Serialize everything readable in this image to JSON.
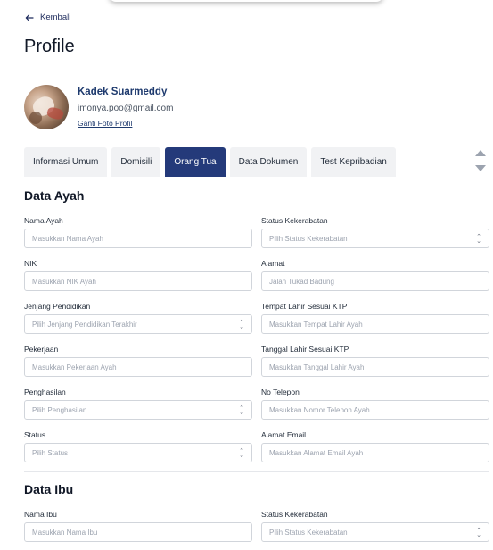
{
  "nav": {
    "back_label": "Kembali"
  },
  "page": {
    "title": "Profile"
  },
  "user": {
    "name": "Kadek Suarmeddy",
    "email": "imonya.poo@gmail.com",
    "change_photo_label": "Ganti Foto Profil"
  },
  "tabs": [
    {
      "label": "Informasi Umum",
      "active": false
    },
    {
      "label": "Domisili",
      "active": false
    },
    {
      "label": "Orang Tua",
      "active": true
    },
    {
      "label": "Data Dokumen",
      "active": false
    },
    {
      "label": "Test Kepribadian",
      "active": false
    }
  ],
  "ayah": {
    "title": "Data Ayah",
    "fields": {
      "nama": {
        "label": "Nama Ayah",
        "placeholder": "Masukkan Nama Ayah"
      },
      "status": {
        "label": "Status Kekerabatan",
        "placeholder": "Pilih Status Kekerabatan"
      },
      "nik": {
        "label": "NIK",
        "placeholder": "Masukkan NIK Ayah"
      },
      "alamat": {
        "label": "Alamat",
        "placeholder": "Jalan Tukad Badung"
      },
      "jenjang": {
        "label": "Jenjang Pendidikan",
        "placeholder": "Pilih Jenjang Pendidikan Terakhir"
      },
      "tempat_lahir": {
        "label": "Tempat Lahir Sesuai KTP",
        "placeholder": "Masukkan Tempat Lahir Ayah"
      },
      "pekerjaan": {
        "label": "Pekerjaan",
        "placeholder": "Masukkan Pekerjaan Ayah"
      },
      "tanggal_lahir": {
        "label": "Tanggal Lahir Sesuai KTP",
        "placeholder": "Masukkan Tanggal Lahir Ayah"
      },
      "penghasilan": {
        "label": "Penghasilan",
        "placeholder": "Pilih Penghasilan"
      },
      "telepon": {
        "label": "No Telepon",
        "placeholder": "Masukkan Nomor Telepon Ayah"
      },
      "status_hidup": {
        "label": "Status",
        "placeholder": "Pilih Status"
      },
      "email": {
        "label": "Alamat Email",
        "placeholder": "Masukkan Alamat Email Ayah"
      }
    }
  },
  "ibu": {
    "title": "Data Ibu",
    "fields": {
      "nama": {
        "label": "Nama Ibu",
        "placeholder": "Masukkan Nama Ibu"
      },
      "status": {
        "label": "Status Kekerabatan",
        "placeholder": "Pilih Status Kekerabatan"
      }
    }
  },
  "colors": {
    "accent": "#243a7a",
    "link": "#1e3a6e",
    "tab_bg": "#f1f2f4",
    "border": "#d1d5db"
  }
}
